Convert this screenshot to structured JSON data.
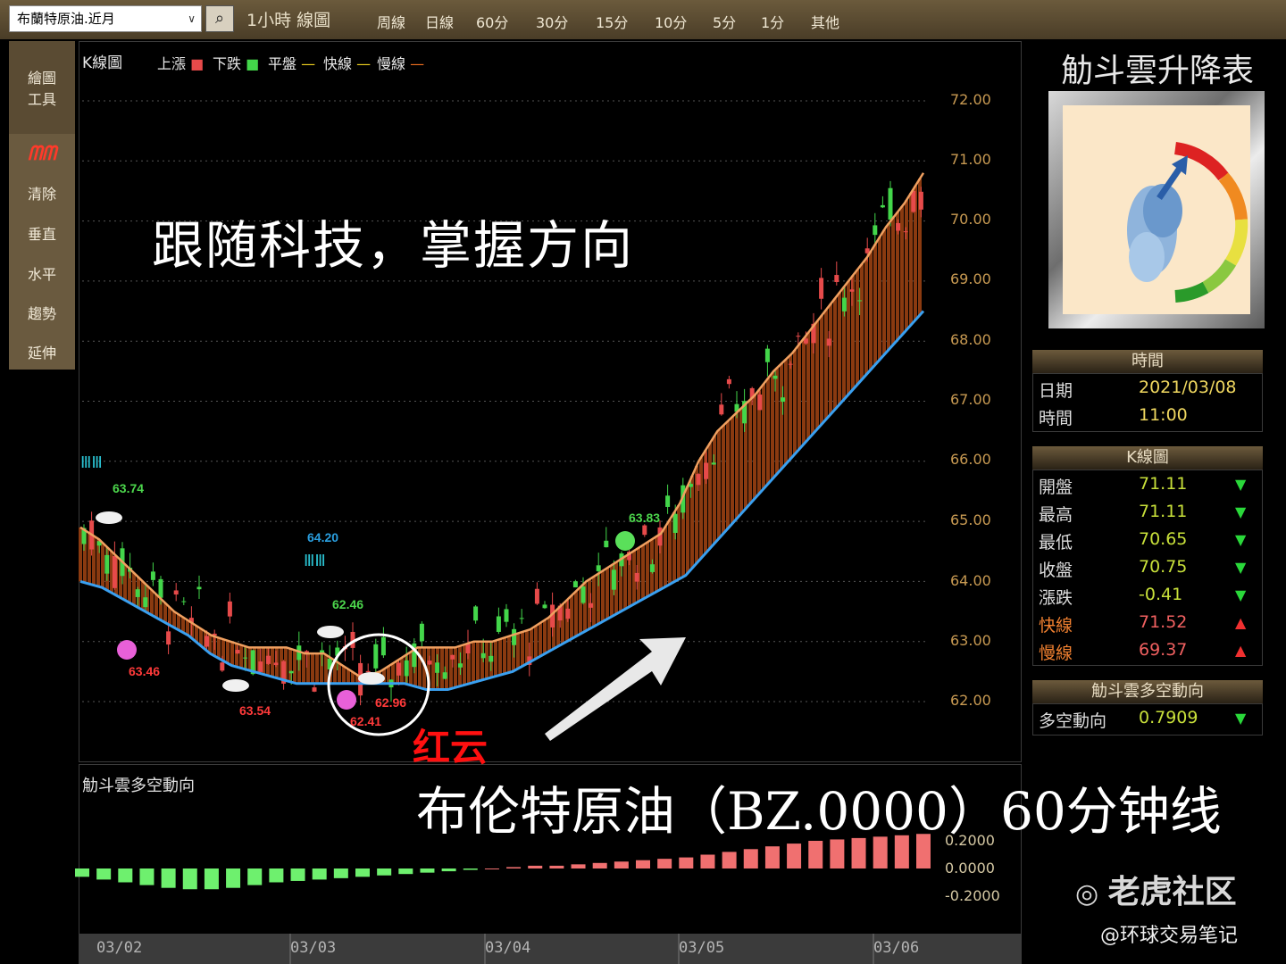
{
  "topbar": {
    "symbol": "布蘭特原油.近月",
    "chart_label": "1小時 線圖",
    "periods": [
      "周線",
      "日線",
      "60分",
      "30分",
      "15分",
      "10分",
      "5分",
      "1分",
      "其他"
    ]
  },
  "sidebar": {
    "draw_tool": "繪圖工具",
    "draw_tool_l1": "繪圖",
    "draw_tool_l2": "工具",
    "items": [
      "清除",
      "垂直",
      "水平",
      "趨勢",
      "延伸"
    ]
  },
  "kchart": {
    "title": "K線圖",
    "legend": [
      {
        "label": "上漲",
        "color": "#e64a4a"
      },
      {
        "label": "下跌",
        "color": "#43d64a"
      },
      {
        "label": "平盤",
        "color": "#f0d020"
      },
      {
        "label": "快線",
        "color": "#f0d020"
      },
      {
        "label": "慢線",
        "color": "#f07020"
      }
    ],
    "y_ticks": [
      "72.00",
      "71.00",
      "70.00",
      "69.00",
      "68.00",
      "67.00",
      "66.00",
      "65.00",
      "64.00",
      "63.00",
      "62.00"
    ],
    "annotations": [
      {
        "text": "63.74",
        "color": "#4cd64c"
      },
      {
        "text": "63.46",
        "color": "#ff3a3a"
      },
      {
        "text": "63.54",
        "color": "#ff3a3a"
      },
      {
        "text": "64.20",
        "color": "#2a9fe0"
      },
      {
        "text": "62.46",
        "color": "#4cd64c"
      },
      {
        "text": "62.96",
        "color": "#ff3a3a"
      },
      {
        "text": "62.41",
        "color": "#ff3a3a"
      },
      {
        "text": "63.83",
        "color": "#4cd64c"
      }
    ]
  },
  "lower": {
    "title": "觔斗雲多空動向",
    "y_ticks": [
      "0.2000",
      "0.0000",
      "-0.2000"
    ]
  },
  "x_ticks": [
    "03/02",
    "03/03",
    "03/04",
    "03/05",
    "03/06"
  ],
  "overlay": {
    "slogan": "跟随科技，掌握方向",
    "red_cloud": "红云",
    "subtitle": "布伦特原油（BZ.0000）60分钟线"
  },
  "right_panel": {
    "title": "觔斗雲升降表",
    "time_section": {
      "header": "時間",
      "rows": [
        {
          "label": "日期",
          "value": "2021/03/08"
        },
        {
          "label": "時間",
          "value": "11:00"
        }
      ]
    },
    "k_section": {
      "header": "K線圖",
      "rows": [
        {
          "label": "開盤",
          "value": "71.11",
          "arrow": "▼"
        },
        {
          "label": "最高",
          "value": "71.11",
          "arrow": "▼"
        },
        {
          "label": "最低",
          "value": "70.65",
          "arrow": "▼"
        },
        {
          "label": "收盤",
          "value": "70.75",
          "arrow": "▼"
        },
        {
          "label": "漲跌",
          "value": "-0.41",
          "arrow": "▼"
        },
        {
          "label": "快線",
          "value": "71.52",
          "arrow": "▲"
        },
        {
          "label": "慢線",
          "value": "69.37",
          "arrow": "▲"
        }
      ]
    },
    "trend_section": {
      "header": "觔斗雲多空動向",
      "rows": [
        {
          "label": "多空動向",
          "value": "0.7909",
          "arrow": "▼"
        }
      ]
    }
  },
  "watermark": {
    "brand": "老虎社区",
    "handle": "@环球交易笔记"
  },
  "chart_data": {
    "type": "candlestick",
    "ylim": [
      61.5,
      72.5
    ],
    "x_ticks": [
      "03/02",
      "03/03",
      "03/04",
      "03/05",
      "03/06"
    ],
    "fast_line": [
      64.9,
      64.7,
      64.4,
      64.1,
      63.8,
      63.5,
      63.3,
      63.1,
      63.0,
      62.9,
      62.9,
      62.9,
      62.8,
      62.8,
      62.6,
      62.4,
      62.5,
      62.7,
      62.9,
      62.9,
      62.9,
      63.0,
      63.0,
      63.1,
      63.2,
      63.4,
      63.7,
      64.0,
      64.2,
      64.4,
      64.6,
      64.8,
      65.3,
      66.0,
      66.5,
      66.8,
      67.1,
      67.5,
      67.8,
      68.2,
      68.6,
      69.0,
      69.4,
      69.9,
      70.3,
      70.8
    ],
    "slow_line": [
      64.0,
      63.9,
      63.7,
      63.5,
      63.3,
      63.1,
      62.8,
      62.6,
      62.5,
      62.4,
      62.3,
      62.3,
      62.3,
      62.3,
      62.3,
      62.3,
      62.2,
      62.2,
      62.3,
      62.4,
      62.5,
      62.7,
      62.9,
      63.1,
      63.3,
      63.5,
      63.7,
      63.9,
      64.1,
      64.5,
      64.9,
      65.3,
      65.7,
      66.1,
      66.5,
      66.9,
      67.3,
      67.7,
      68.1,
      68.5
    ],
    "oscillator": [
      -0.06,
      -0.08,
      -0.1,
      -0.12,
      -0.14,
      -0.15,
      -0.15,
      -0.14,
      -0.12,
      -0.1,
      -0.09,
      -0.08,
      -0.07,
      -0.06,
      -0.05,
      -0.04,
      -0.03,
      -0.02,
      -0.01,
      0.0,
      0.01,
      0.02,
      0.02,
      0.03,
      0.04,
      0.05,
      0.06,
      0.07,
      0.08,
      0.1,
      0.12,
      0.14,
      0.16,
      0.18,
      0.2,
      0.21,
      0.22,
      0.23,
      0.24,
      0.25
    ],
    "oscillator_ylim": [
      -0.3,
      0.35
    ]
  }
}
